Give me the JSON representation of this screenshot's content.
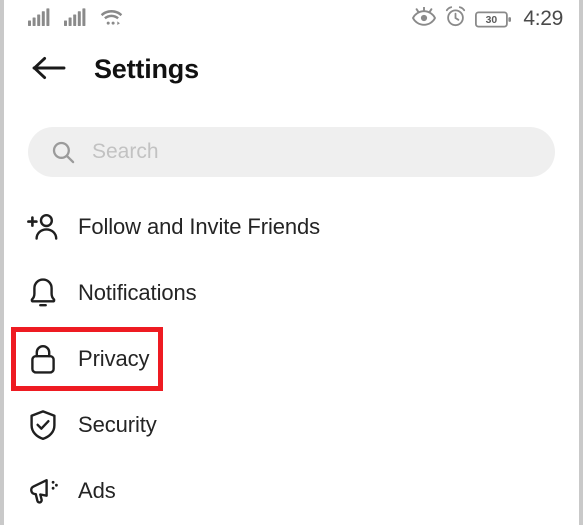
{
  "status_bar": {
    "signal_1_icon": "cellular-signal-icon",
    "signal_2_icon": "cellular-signal-icon",
    "wifi_icon": "wifi-icon",
    "eye_comfort_icon": "eye-icon",
    "alarm_icon": "alarm-clock-icon",
    "battery_icon": "battery-icon",
    "battery_level": "30",
    "time": "4:29"
  },
  "header": {
    "back_icon": "arrow-left-icon",
    "title": "Settings"
  },
  "search": {
    "icon": "search-icon",
    "placeholder": "Search",
    "value": ""
  },
  "list": {
    "items": [
      {
        "label": "Follow and Invite Friends",
        "icon": "person-add-icon",
        "highlighted": false
      },
      {
        "label": "Notifications",
        "icon": "bell-icon",
        "highlighted": false
      },
      {
        "label": "Privacy",
        "icon": "lock-icon",
        "highlighted": true
      },
      {
        "label": "Security",
        "icon": "shield-check-icon",
        "highlighted": false
      },
      {
        "label": "Ads",
        "icon": "megaphone-icon",
        "highlighted": false
      }
    ]
  },
  "annotation": {
    "highlight_color": "#ee1b22",
    "target": "Privacy"
  },
  "colors": {
    "background": "#ffffff",
    "search_background": "#efefef",
    "text_primary": "#242424",
    "text_placeholder": "#c2c2c2",
    "status_icon": "#8a8a8a",
    "highlight": "#ee1b22"
  }
}
